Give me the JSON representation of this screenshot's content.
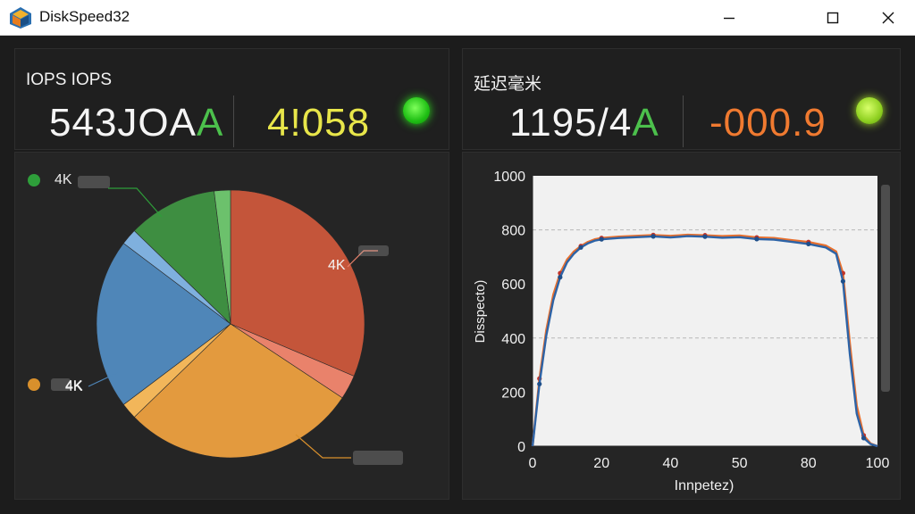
{
  "window": {
    "title": "DiskSpeed32",
    "icon": "diskspeed-app-icon",
    "controls": [
      "minimize-icon",
      "maximize-icon",
      "close-icon"
    ]
  },
  "iops_panel": {
    "title": "IOPS IOPS",
    "primary_value": "543JOA",
    "primary_suffix": "A",
    "secondary_value": "4!058",
    "status": "green"
  },
  "latency_panel": {
    "title": "延迟毫米",
    "primary_value": "1195/4",
    "primary_suffix": "A",
    "secondary_value": "-000.9",
    "status": "green"
  },
  "pie_panel": {
    "legend": [
      {
        "label": "4K",
        "color": "#2e9e3a"
      },
      {
        "label": "4K",
        "color": "#d9902c"
      }
    ],
    "slice_labels": [
      "4K",
      "4K"
    ],
    "chart_data": {
      "type": "pie",
      "values": [
        32,
        3,
        29,
        2,
        21,
        2,
        11,
        2
      ],
      "colors": [
        "#c4553a",
        "#e9826b",
        "#e39a3e",
        "#f2b65a",
        "#4f86b8",
        "#7fb0de",
        "#3e8e41",
        "#6cc16c"
      ]
    }
  },
  "line_panel": {
    "chart_data": {
      "type": "line",
      "xlabel": "Innpetez)",
      "ylabel": "Disspecto)",
      "xlim": [
        0,
        100
      ],
      "ylim": [
        0,
        1000
      ],
      "xticks": [
        "0",
        "20",
        "40",
        "50",
        "80",
        "100"
      ],
      "yticks": [
        "0",
        "200",
        "400",
        "600",
        "800",
        "1000"
      ],
      "grid": "dashed at 400 and 800",
      "series": [
        {
          "color": "#e8702e",
          "x": [
            0,
            2,
            4,
            6,
            8,
            10,
            12,
            14,
            16,
            18,
            20,
            25,
            30,
            35,
            40,
            45,
            50,
            55,
            60,
            65,
            70,
            75,
            80,
            85,
            88,
            90,
            92,
            94,
            96,
            98,
            100
          ],
          "y": [
            0,
            250,
            430,
            560,
            640,
            690,
            720,
            740,
            755,
            765,
            770,
            775,
            778,
            781,
            778,
            782,
            780,
            777,
            779,
            772,
            770,
            762,
            755,
            742,
            720,
            640,
            380,
            150,
            40,
            10,
            0
          ]
        },
        {
          "color": "#2d63a6",
          "x": [
            0,
            2,
            4,
            6,
            8,
            10,
            12,
            14,
            16,
            18,
            20,
            25,
            30,
            35,
            40,
            45,
            50,
            55,
            60,
            65,
            70,
            75,
            80,
            85,
            88,
            90,
            92,
            94,
            96,
            98,
            100
          ],
          "y": [
            0,
            230,
            410,
            540,
            625,
            680,
            712,
            735,
            750,
            760,
            765,
            770,
            773,
            776,
            772,
            777,
            775,
            771,
            773,
            766,
            764,
            756,
            748,
            735,
            712,
            610,
            340,
            120,
            30,
            8,
            0
          ]
        }
      ]
    }
  }
}
